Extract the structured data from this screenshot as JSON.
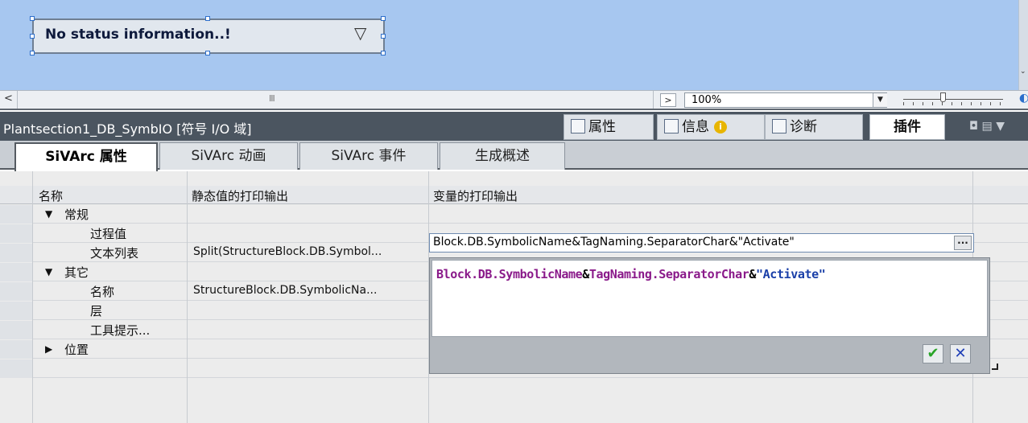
{
  "canvas": {
    "status_text": "No status information..!",
    "dropdown_glyph": "▽"
  },
  "hscroll": {
    "left_arrow": "<",
    "grip": "III",
    "right_arrow": ">"
  },
  "zoom": {
    "value": "100%",
    "dropdown_glyph": "▼"
  },
  "inspector": {
    "title": "Plantsection1_DB_SymbIO [符号 I/O 域]",
    "tabs": [
      {
        "label": "属性",
        "icon": "properties-icon"
      },
      {
        "label": "信息",
        "icon": "info-icon"
      },
      {
        "label": "诊断",
        "icon": "diagnostics-icon"
      },
      {
        "label": "插件",
        "icon": ""
      }
    ],
    "info_badge": "i",
    "window_controls": "◘ ▤ ▼"
  },
  "subtabs": [
    "SiVArc 属性",
    "SiVArc 动画",
    "SiVArc 事件",
    "生成概述"
  ],
  "grid": {
    "headers": [
      "名称",
      "静态值的打印输出",
      "变量的打印输出"
    ],
    "rows": [
      {
        "name": "常规",
        "expander": "▼",
        "static": "",
        "variable": ""
      },
      {
        "name": "过程值",
        "expander": "",
        "static": "",
        "variable": ""
      },
      {
        "name": "文本列表",
        "expander": "",
        "static": "Split(StructureBlock.DB.Symbol...",
        "variable": ""
      },
      {
        "name": "其它",
        "expander": "▼",
        "static": "",
        "variable": ""
      },
      {
        "name": "名称",
        "expander": "",
        "static": "StructureBlock.DB.SymbolicNa...",
        "variable": ""
      },
      {
        "name": "层",
        "expander": "",
        "static": "",
        "variable": ""
      },
      {
        "name": "工具提示...",
        "expander": "",
        "static": "",
        "variable": ""
      },
      {
        "name": "位置",
        "expander": "▶",
        "static": "",
        "variable": ""
      }
    ]
  },
  "active_input": {
    "value": "Block.DB.SymbolicName&TagNaming.SeparatorChar&\"Activate\"",
    "ellipsis": "..."
  },
  "editor": {
    "tokens": [
      {
        "text": "Block.DB.SymbolicName",
        "color": "#8a1a8a"
      },
      {
        "text": "&",
        "color": "#000000"
      },
      {
        "text": "TagNaming.SeparatorChar",
        "color": "#8a1a8a"
      },
      {
        "text": "&",
        "color": "#000000"
      },
      {
        "text": "\"Activate\"",
        "color": "#1a3fa8"
      }
    ],
    "ok_glyph": "✔",
    "cancel_glyph": "✕"
  },
  "colors": {
    "canvas_bg": "#a7c7f0",
    "inspector_bar": "#4b5560",
    "expr_identifier": "#8a1a8a",
    "expr_string": "#1a3fa8"
  }
}
